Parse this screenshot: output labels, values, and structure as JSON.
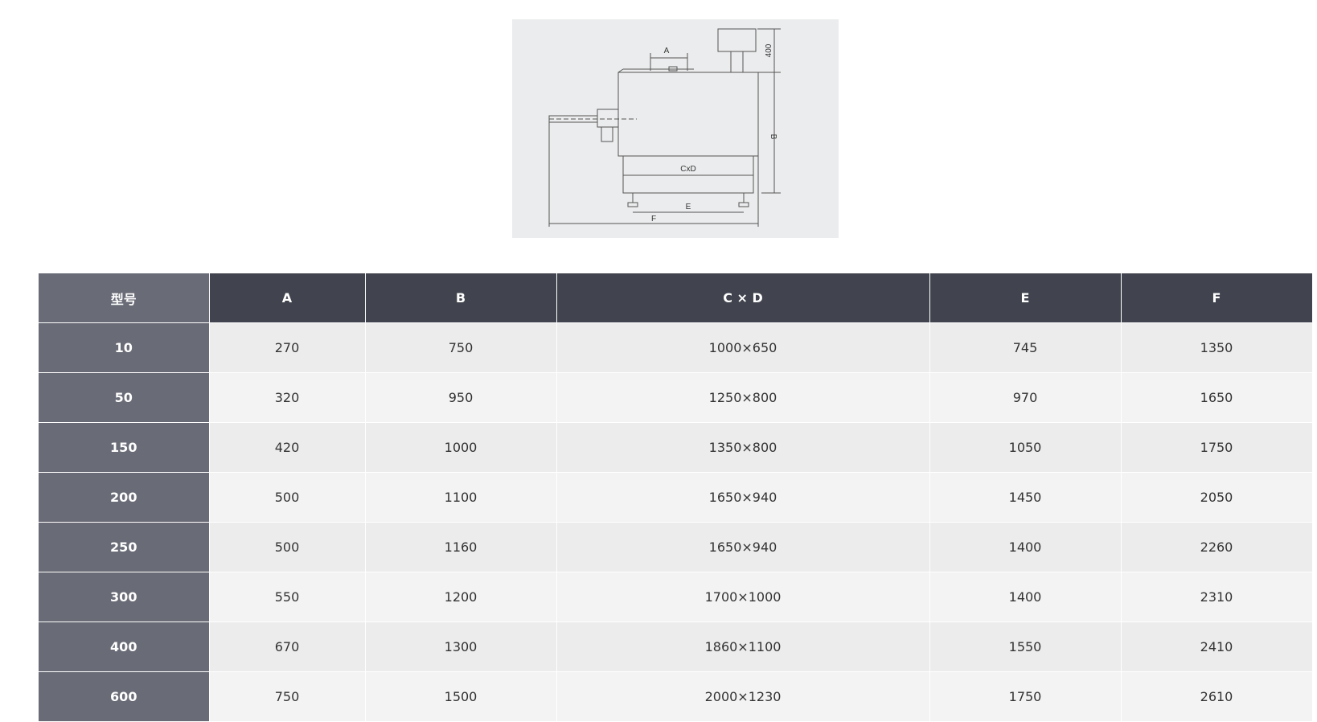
{
  "figure": {
    "labels": {
      "a": "A",
      "h400": "400",
      "b": "B",
      "cxd": "CxD",
      "e": "E",
      "f": "F"
    }
  },
  "table": {
    "headers": [
      "型号",
      "A",
      "B",
      "C × D",
      "E",
      "F"
    ],
    "rows": [
      {
        "model": "10",
        "a": "270",
        "b": "750",
        "cxd": "1000×650",
        "e": "745",
        "f": "1350"
      },
      {
        "model": "50",
        "a": "320",
        "b": "950",
        "cxd": "1250×800",
        "e": "970",
        "f": "1650"
      },
      {
        "model": "150",
        "a": "420",
        "b": "1000",
        "cxd": "1350×800",
        "e": "1050",
        "f": "1750"
      },
      {
        "model": "200",
        "a": "500",
        "b": "1100",
        "cxd": "1650×940",
        "e": "1450",
        "f": "2050"
      },
      {
        "model": "250",
        "a": "500",
        "b": "1160",
        "cxd": "1650×940",
        "e": "1400",
        "f": "2260"
      },
      {
        "model": "300",
        "a": "550",
        "b": "1200",
        "cxd": "1700×1000",
        "e": "1400",
        "f": "2310"
      },
      {
        "model": "400",
        "a": "670",
        "b": "1300",
        "cxd": "1860×1100",
        "e": "1550",
        "f": "2410"
      },
      {
        "model": "600",
        "a": "750",
        "b": "1500",
        "cxd": "2000×1230",
        "e": "1750",
        "f": "2610"
      }
    ]
  }
}
